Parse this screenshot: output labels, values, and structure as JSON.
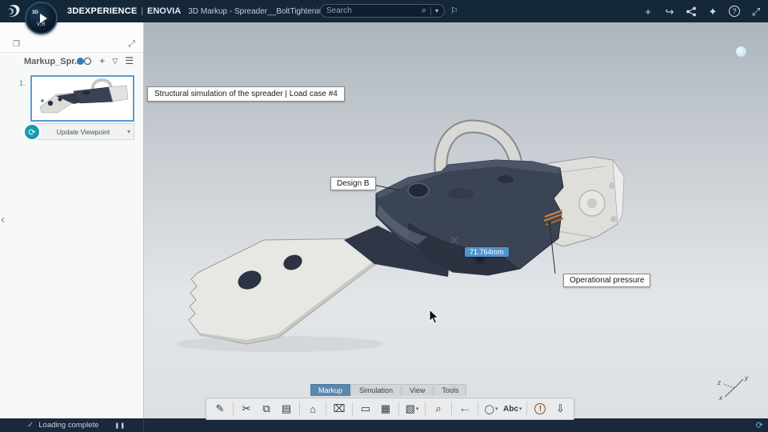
{
  "topbar": {
    "brand": "3DEXPERIENCE",
    "sep": "|",
    "app": "ENOVIA",
    "doc_title": "3D Markup - Spreader__BoltTightenin...",
    "search_placeholder": "Search",
    "compass_top": "3D",
    "compass_bottom": "V,R"
  },
  "icons": {
    "chevron_down": "▾",
    "plus": "+",
    "share_forward": "↪",
    "assistant": "✦",
    "help": "?",
    "fullscreen": "⤢",
    "tag": "⚐",
    "search": "⌕",
    "panel_window": "❐",
    "panel_expand": "⤢",
    "filter": "▽",
    "menu": "☰",
    "refresh": "⟳",
    "heart": "♡",
    "check": "✓",
    "pause": "❚❚",
    "collapse_left": "‹"
  },
  "left_panel": {
    "title": "Markup_Spr...",
    "slide_number": "1.",
    "update_viewpoint_label": "Update Viewpoint"
  },
  "viewport": {
    "scene_label": "Structural simulation of the spreader | Load case #4",
    "annotations": [
      {
        "label": "Design B"
      },
      {
        "label": "Operational pressure"
      }
    ],
    "measurement_value": "71.764mm",
    "axes": {
      "x": "x",
      "y": "y",
      "z": "z"
    }
  },
  "ribbon": {
    "tabs": [
      {
        "label": "Markup"
      },
      {
        "label": "Simulation"
      },
      {
        "label": "View"
      },
      {
        "label": "Tools"
      }
    ],
    "buttons": [
      {
        "name": "create-markup",
        "glyph": "✎"
      },
      {
        "name": "cut",
        "glyph": "✂"
      },
      {
        "name": "copy",
        "glyph": "⧉"
      },
      {
        "name": "paste",
        "glyph": "▤"
      },
      {
        "name": "home",
        "glyph": "⌂"
      },
      {
        "name": "delete-markup",
        "glyph": "⌧"
      },
      {
        "name": "slide",
        "glyph": "▭"
      },
      {
        "name": "table",
        "glyph": "▦"
      },
      {
        "name": "section-box",
        "glyph": "▧"
      },
      {
        "name": "zoom",
        "glyph": "⌕"
      },
      {
        "name": "back",
        "glyph": "←"
      },
      {
        "name": "circle-tool",
        "glyph": "◯"
      },
      {
        "name": "text-tool",
        "glyph": "Abc"
      },
      {
        "name": "important",
        "glyph": "!"
      },
      {
        "name": "save",
        "glyph": "⇩"
      }
    ]
  },
  "statusbar": {
    "message": "Loading complete"
  },
  "colors": {
    "topbar_bg": "#152839",
    "accent_blue": "#4f94cd",
    "active_tab": "#5b87ad",
    "teal": "#1799ad",
    "model_dark": "#3b4454",
    "model_light": "#e6e6e3",
    "copper": "#b97a3e"
  }
}
